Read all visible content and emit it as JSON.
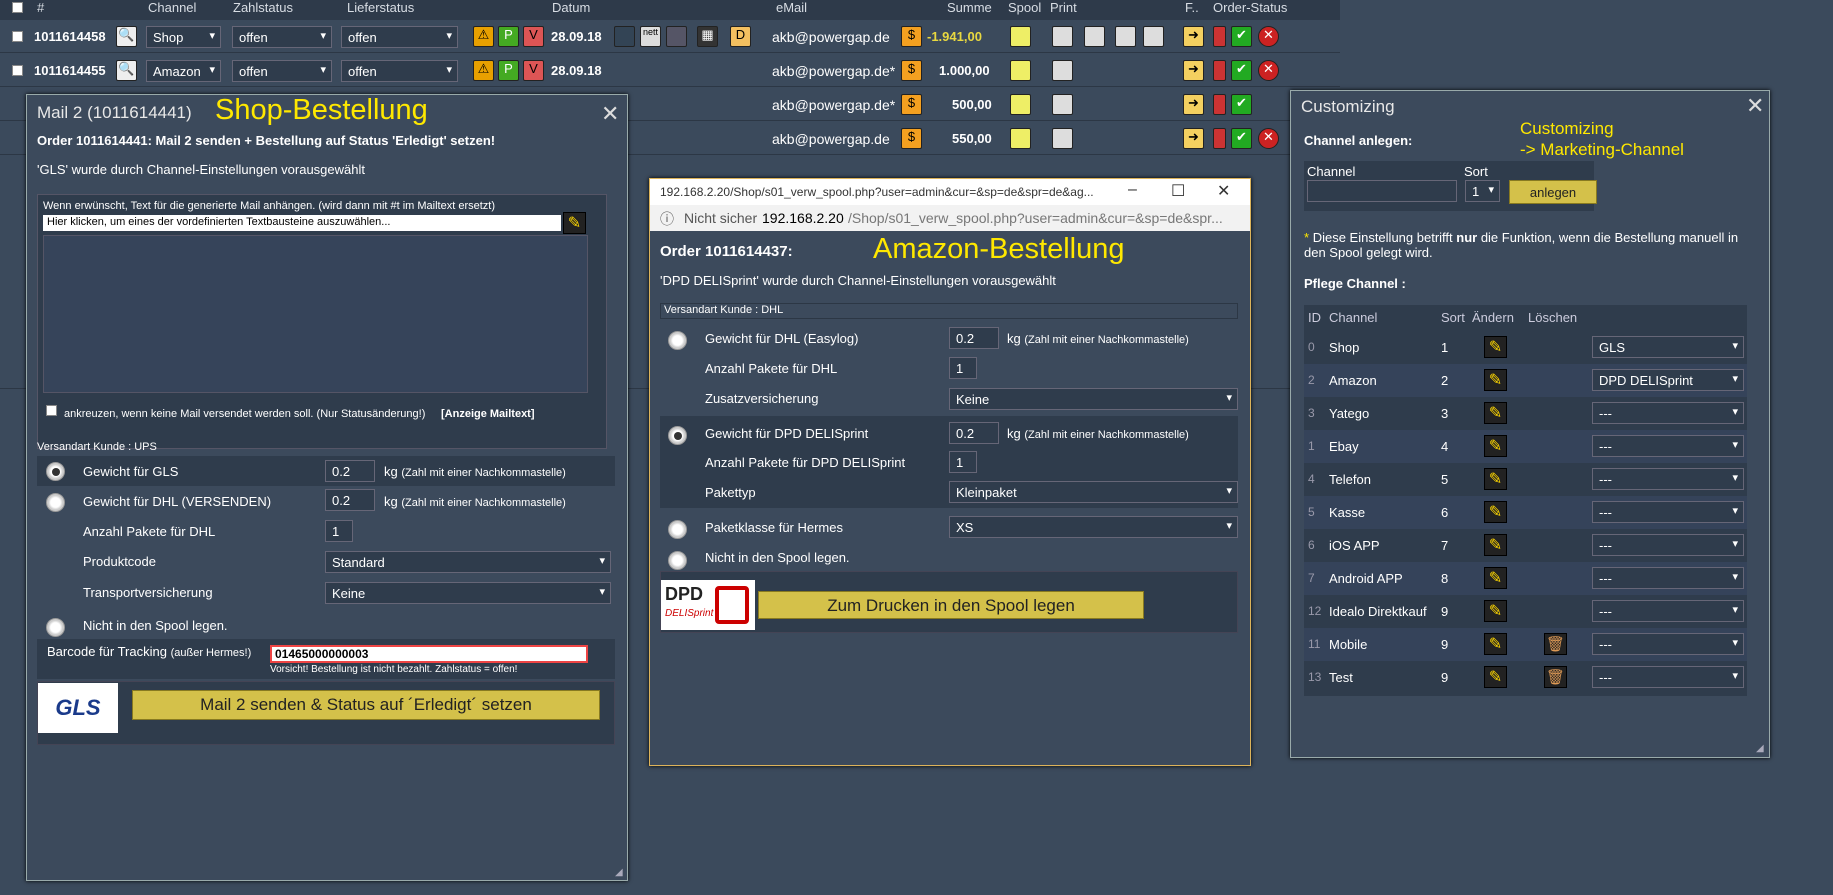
{
  "header": {
    "hash": "#",
    "channel": "Channel",
    "zahlstatus": "Zahlstatus",
    "lieferstatus": "Lieferstatus",
    "datum": "Datum",
    "email": "eMail",
    "summe": "Summe",
    "spool": "Spool",
    "print": "Print",
    "f": "F..",
    "order_status": "Order-Status"
  },
  "rows": [
    {
      "id": "1011614458",
      "channel": "Shop",
      "zahl": "offen",
      "liefer": "offen",
      "datum": "28.09.18",
      "email": "akb@powergap.de",
      "summe": "-1.941,00"
    },
    {
      "id": "1011614455",
      "channel": "Amazon",
      "zahl": "offen",
      "liefer": "offen",
      "datum": "28.09.18",
      "email": "akb@powergap.de*",
      "summe": "1.000,00"
    },
    {
      "email": "akb@powergap.de*",
      "summe": "500,00"
    },
    {
      "email": "akb@powergap.de",
      "summe": "550,00"
    }
  ],
  "mail_dialog": {
    "title": "Mail 2 (1011614441)",
    "label": "Shop-Bestellung",
    "heading": "Order 1011614441: Mail 2 senden + Bestellung auf Status 'Erledigt' setzen!",
    "preselect": "'GLS' wurde durch Channel-Einstellungen vorausgewählt",
    "text_hint": "Wenn erwünscht, Text für die generierte Mail anhängen. (wird dann mit #t im Mailtext ersetzt)",
    "text_select": "Hier klicken, um eines der vordefinierten Textbausteine auszuwählen...",
    "no_mail_label": "ankreuzen, wenn keine Mail versendet werden soll. (Nur Statusänderung!)",
    "show_mail_text": "[Anzeige Mailtext]",
    "versandart": "Versandart Kunde : UPS",
    "gls_label": "Gewicht für GLS",
    "gls_weight": "0.2",
    "dhl_label": "Gewicht für DHL (VERSENDEN)",
    "dhl_weight": "0.2",
    "kg": "kg",
    "kg_hint": "(Zahl mit einer Nachkommastelle)",
    "dhl_packets_label": "Anzahl Pakete für DHL",
    "dhl_packets": "1",
    "produktcode_label": "Produktcode",
    "produktcode": "Standard",
    "transport_label": "Transportversicherung",
    "transport": "Keine",
    "no_spool": "Nicht in den Spool legen.",
    "barcode_label": "Barcode für Tracking",
    "barcode_hint": "(außer Hermes!)",
    "barcode": "01465000000003",
    "warning": "Vorsicht! Bestellung ist nicht bezahlt. Zahlstatus = offen!",
    "gls_logo": "GLS",
    "submit": "Mail 2 senden & Status auf ´Erledigt´ setzen"
  },
  "spool_window": {
    "titlebar": "192.168.2.20/Shop/s01_verw_spool.php?user=admin&cur=&sp=de&spr=de&ag...",
    "not_secure": "Nicht sicher",
    "url_host": "192.168.2.20",
    "url_path": "/Shop/s01_verw_spool.php?user=admin&cur=&sp=de&spr...",
    "heading": "Order 1011614437:",
    "label": "Amazon-Bestellung",
    "preselect": "'DPD DELISprint' wurde durch Channel-Einstellungen vorausgewählt",
    "versandart": "Versandart Kunde : DHL",
    "dhl_label": "Gewicht für DHL (Easylog)",
    "dhl_weight": "0.2",
    "kg": "kg",
    "kg_hint": "(Zahl mit einer Nachkommastelle)",
    "dhl_packets_label": "Anzahl Pakete für DHL",
    "dhl_packets": "1",
    "zusatz_label": "Zusatzversicherung",
    "zusatz": "Keine",
    "dpd_label": "Gewicht für DPD DELISprint",
    "dpd_weight": "0.2",
    "dpd_packets_label": "Anzahl Pakete für DPD DELISprint",
    "dpd_packets": "1",
    "pakettyp_label": "Pakettyp",
    "pakettyp": "Kleinpaket",
    "hermes_label": "Paketklasse für Hermes",
    "hermes": "XS",
    "no_spool": "Nicht in den Spool legen.",
    "dpd_logo": "DPD",
    "dpd_sub": "DELISprint",
    "submit": "Zum Drucken in den Spool legen",
    "min": "–",
    "max": "☐",
    "close": "✕"
  },
  "customizing": {
    "title": "Customizing",
    "note1": "Customizing",
    "note2": "-> Marketing-Channel",
    "create_heading": "Channel anlegen:",
    "channel_col": "Channel",
    "sort_col": "Sort",
    "sort_val": "1",
    "create_btn": "anlegen",
    "info_star": "*",
    "info_text1": "Diese Einstellung betrifft ",
    "info_bold": "nur",
    "info_text2": " die Funktion, wenn die Bestellung manuell in den Spool gelegt wird.",
    "pflege": "Pflege Channel :",
    "cols": {
      "id": "ID",
      "channel": "Channel",
      "sort": "Sort",
      "edit": "Ändern",
      "del": "Löschen"
    },
    "channels": [
      {
        "id": "0",
        "name": "Shop",
        "sort": "1",
        "ship": "GLS",
        "del": false
      },
      {
        "id": "2",
        "name": "Amazon",
        "sort": "2",
        "ship": "DPD DELISprint",
        "del": false
      },
      {
        "id": "3",
        "name": "Yatego",
        "sort": "3",
        "ship": "---",
        "del": false
      },
      {
        "id": "1",
        "name": "Ebay",
        "sort": "4",
        "ship": "---",
        "del": false
      },
      {
        "id": "4",
        "name": "Telefon",
        "sort": "5",
        "ship": "---",
        "del": false
      },
      {
        "id": "5",
        "name": "Kasse",
        "sort": "6",
        "ship": "---",
        "del": false
      },
      {
        "id": "6",
        "name": "iOS APP",
        "sort": "7",
        "ship": "---",
        "del": false
      },
      {
        "id": "7",
        "name": "Android APP",
        "sort": "8",
        "ship": "---",
        "del": false
      },
      {
        "id": "12",
        "name": "Idealo Direktkauf",
        "sort": "9",
        "ship": "---",
        "del": false
      },
      {
        "id": "11",
        "name": "Mobile",
        "sort": "9",
        "ship": "---",
        "del": true
      },
      {
        "id": "13",
        "name": "Test",
        "sort": "9",
        "ship": "---",
        "del": true
      }
    ]
  }
}
